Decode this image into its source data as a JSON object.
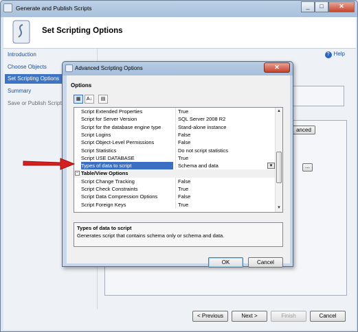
{
  "window": {
    "title": "Generate and Publish Scripts",
    "controls": [
      "_",
      "□",
      "✕"
    ]
  },
  "header": {
    "title": "Set Scripting Options"
  },
  "nav": {
    "items": [
      {
        "label": "Introduction",
        "state": "normal"
      },
      {
        "label": "Choose Objects",
        "state": "normal"
      },
      {
        "label": "Set Scripting Options",
        "state": "selected"
      },
      {
        "label": "Summary",
        "state": "normal"
      },
      {
        "label": "Save or Publish Scripts",
        "state": "disabled"
      }
    ]
  },
  "help": {
    "label": "Help"
  },
  "background": {
    "advanced_label": "anced",
    "ellipsis_label": "..."
  },
  "footer": {
    "previous": "< Previous",
    "next": "Next >",
    "finish": "Finish",
    "cancel": "Cancel"
  },
  "dialog": {
    "title": "Advanced Scripting Options",
    "close": "✕",
    "options_label": "Options",
    "rows": [
      {
        "type": "prop",
        "key": "Script Extended Properties",
        "value": "True"
      },
      {
        "type": "prop",
        "key": "Script for Server Version",
        "value": "SQL Server 2008 R2"
      },
      {
        "type": "prop",
        "key": "Script for the database engine type",
        "value": "Stand-alone instance"
      },
      {
        "type": "prop",
        "key": "Script Logins",
        "value": "False"
      },
      {
        "type": "prop",
        "key": "Script Object-Level Permissions",
        "value": "False"
      },
      {
        "type": "prop",
        "key": "Script Statistics",
        "value": "Do not script statistics"
      },
      {
        "type": "prop",
        "key": "Script USE DATABASE",
        "value": "True"
      },
      {
        "type": "selected",
        "key": "Types of data to script",
        "value": "Schema and data"
      },
      {
        "type": "category",
        "key": "Table/View Options",
        "value": ""
      },
      {
        "type": "prop",
        "key": "Script Change Tracking",
        "value": "False"
      },
      {
        "type": "prop",
        "key": "Script Check Constraints",
        "value": "True"
      },
      {
        "type": "prop",
        "key": "Script Data Compression Options",
        "value": "False"
      },
      {
        "type": "prop",
        "key": "Script Foreign Keys",
        "value": "True"
      }
    ],
    "description": {
      "title": "Types of data to script",
      "text": "Generates script that contains schema only or schema and data."
    },
    "ok": "OK",
    "cancel": "Cancel"
  },
  "colors": {
    "selection": "#3a6fc4",
    "nav_selected": "#3e74c4",
    "arrow": "#d42020"
  }
}
